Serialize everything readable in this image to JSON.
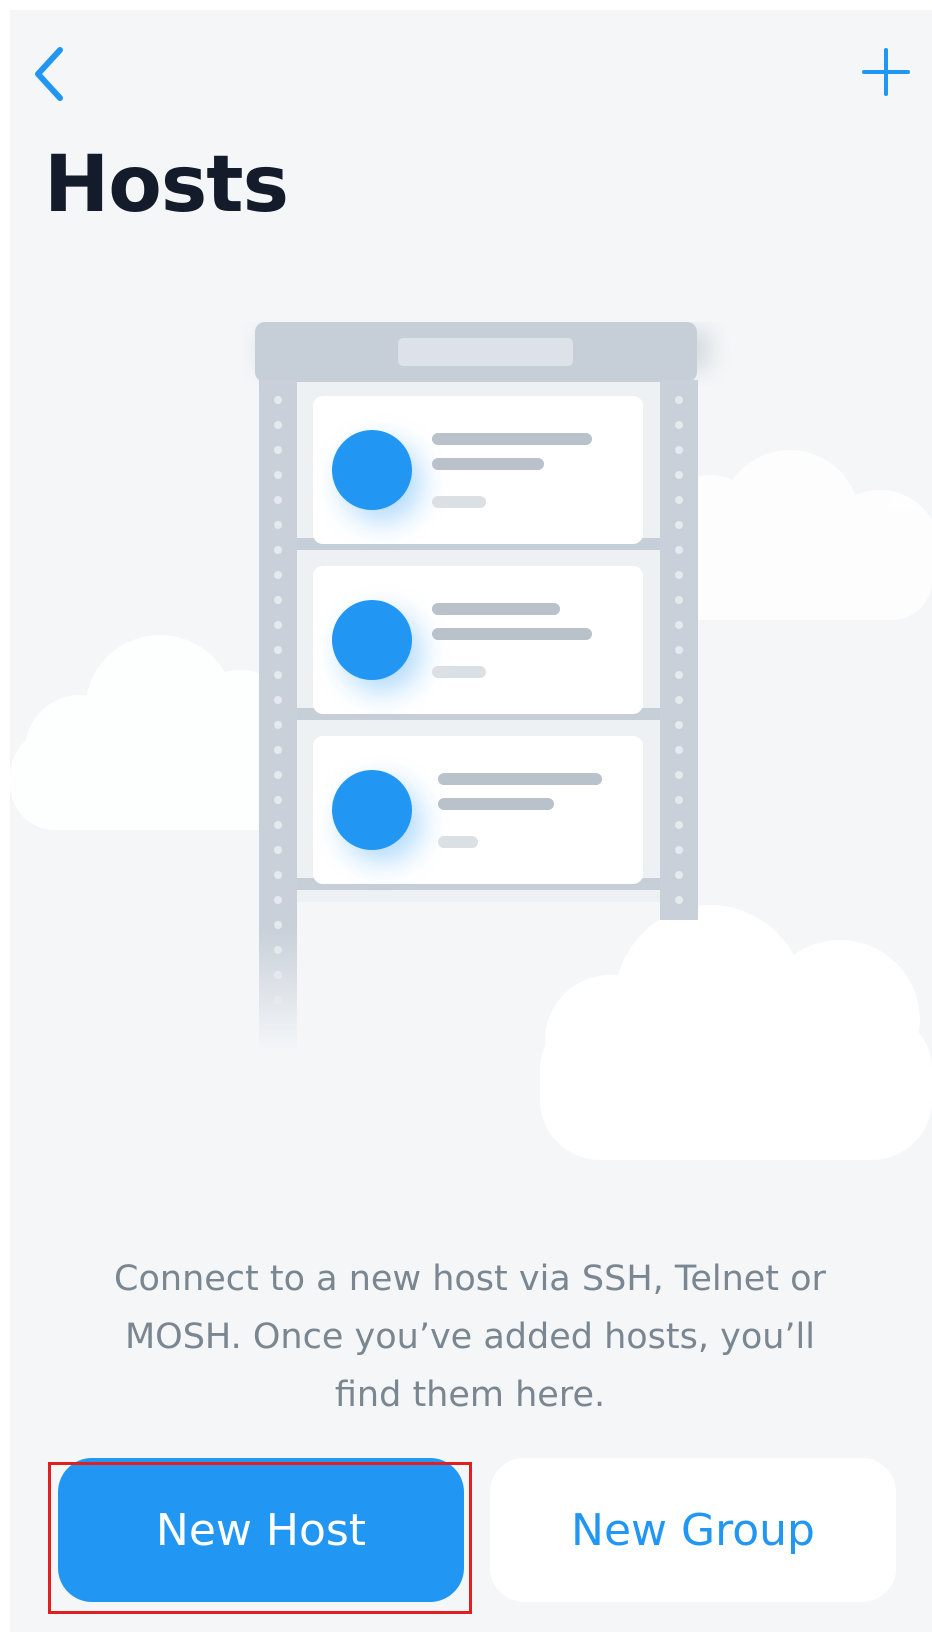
{
  "header": {
    "back_icon": "chevron-left-icon",
    "add_icon": "plus-icon",
    "title": "Hosts"
  },
  "empty_state": {
    "illustration": "server-rack-illustration",
    "message": "Connect to a new host via SSH, Telnet or MOSH. Once you’ve added hosts, you’ll find them here."
  },
  "actions": {
    "new_host_label": "New Host",
    "new_group_label": "New Group"
  },
  "colors": {
    "accent": "#2196f3",
    "title": "#141b2b",
    "message": "#7a8690",
    "background": "#f4f6f8",
    "highlight": "#e02020"
  }
}
